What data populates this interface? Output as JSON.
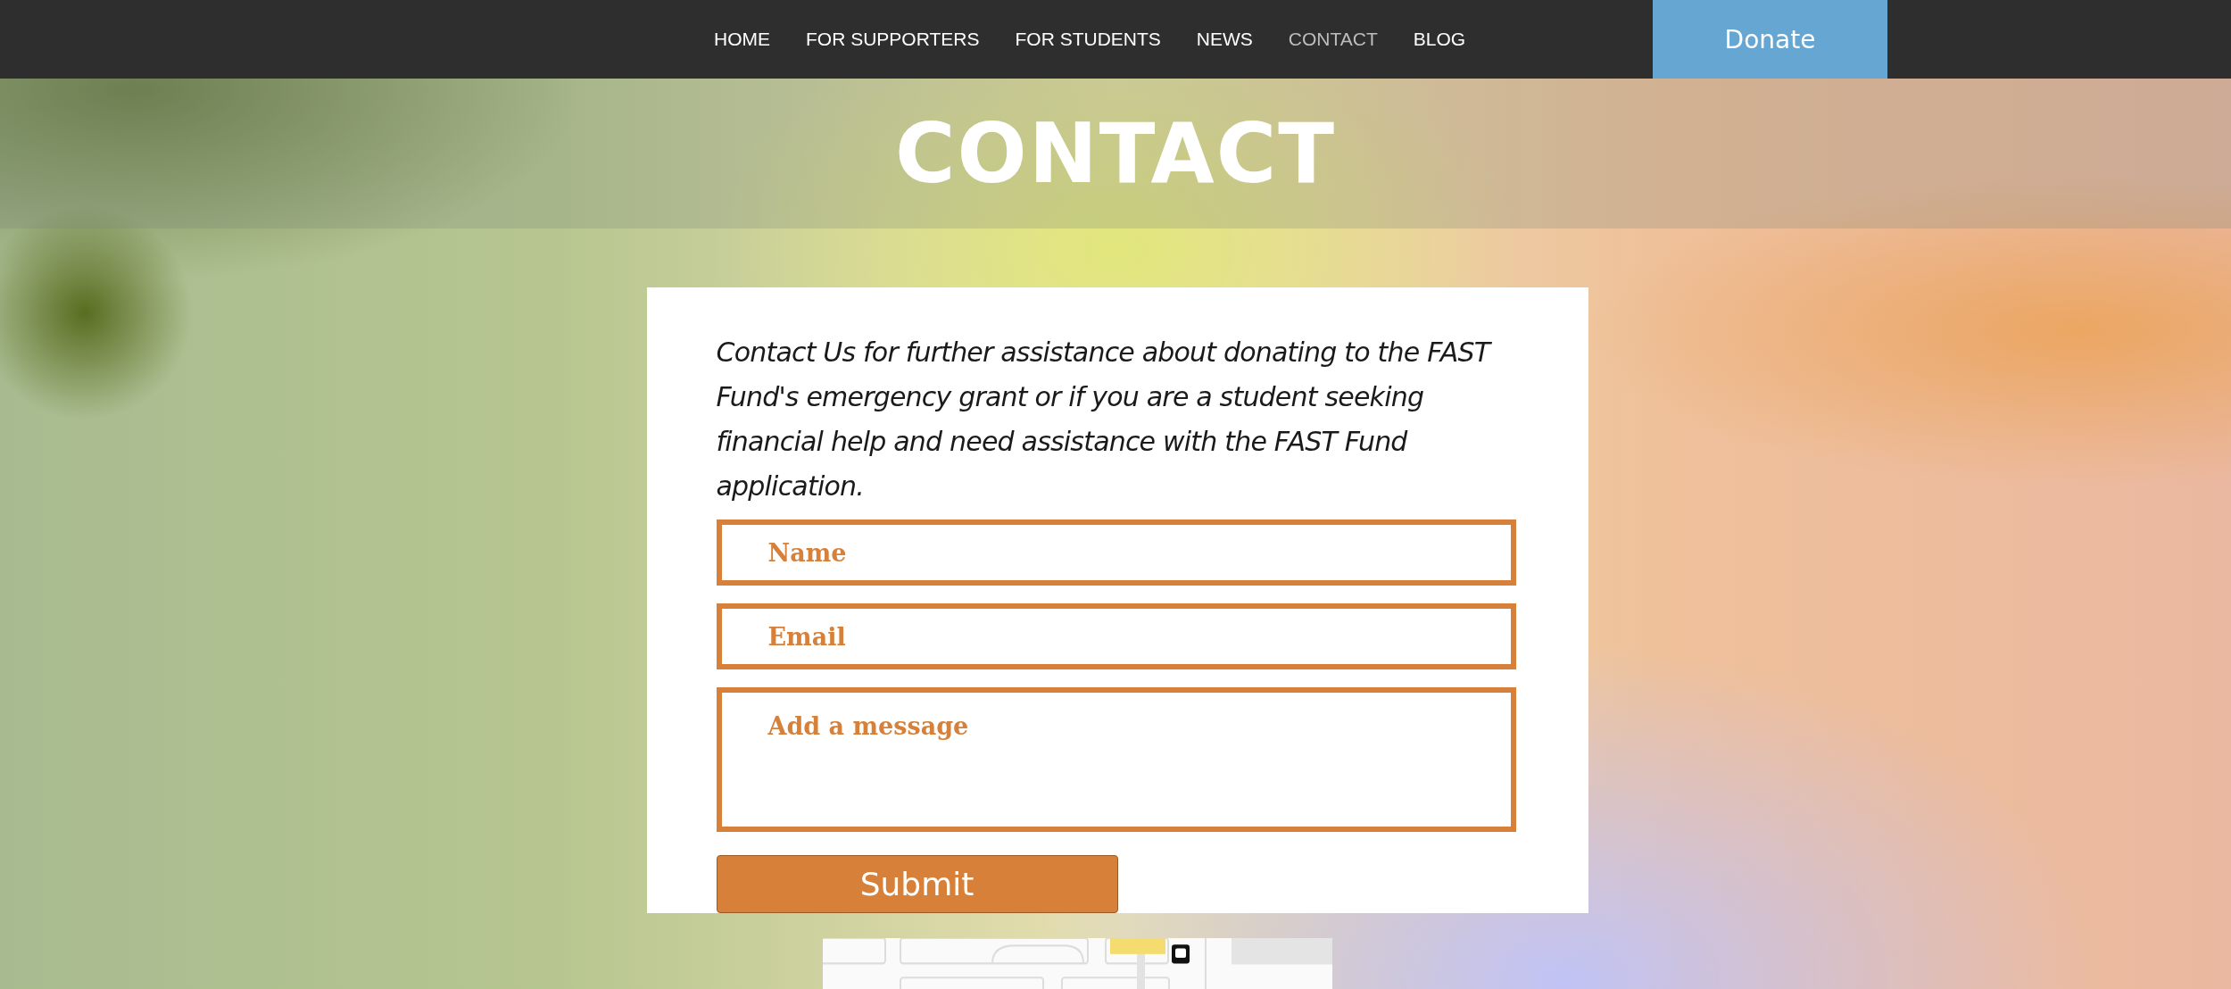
{
  "nav": {
    "items": [
      {
        "label": "HOME",
        "selected": false
      },
      {
        "label": "FOR SUPPORTERS",
        "selected": false
      },
      {
        "label": "FOR STUDENTS",
        "selected": false
      },
      {
        "label": "NEWS",
        "selected": false
      },
      {
        "label": "CONTACT",
        "selected": true
      },
      {
        "label": "BLOG",
        "selected": false
      }
    ],
    "donate_button": "Donate"
  },
  "page_title": "CONTACT",
  "contact_form": {
    "intro": "Contact Us for further assistance about donating to the FAST Fund's emergency grant or if  you are a student seeking financial help and need assistance with the FAST Fund application.",
    "fields": [
      {
        "kind": "line",
        "placeholder": "Name"
      },
      {
        "kind": "line",
        "placeholder": "Email"
      },
      {
        "kind": "area",
        "placeholder": "Add a message"
      }
    ],
    "submit_button": "Submit"
  }
}
